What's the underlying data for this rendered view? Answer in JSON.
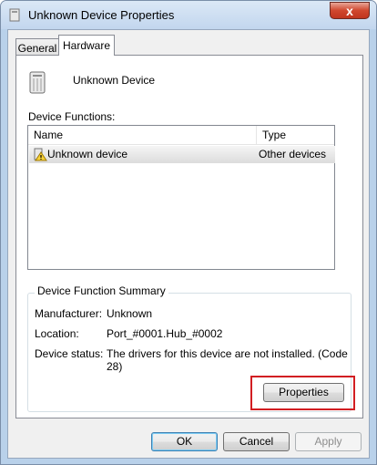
{
  "window": {
    "title": "Unknown Device Properties",
    "close_glyph": "x"
  },
  "tabs": [
    {
      "label": "General"
    },
    {
      "label": "Hardware"
    }
  ],
  "device": {
    "name": "Unknown Device",
    "icon": "device-icon"
  },
  "functions": {
    "label": "Device Functions:",
    "columns": [
      "Name",
      "Type"
    ],
    "rows": [
      {
        "name": "Unknown device",
        "type": "Other devices",
        "icon": "warning-device-icon"
      }
    ]
  },
  "summary": {
    "title": "Device Function Summary",
    "manufacturer_label": "Manufacturer:",
    "manufacturer_value": "Unknown",
    "location_label": "Location:",
    "location_value": "Port_#0001.Hub_#0002",
    "status_label": "Device status:",
    "status_value": "The drivers for this device are not installed. (Code 28)",
    "properties_button": "Properties"
  },
  "footer": {
    "ok": "OK",
    "cancel": "Cancel",
    "apply": "Apply"
  },
  "colors": {
    "highlight": "#d21e22",
    "close": "#c0351e"
  }
}
